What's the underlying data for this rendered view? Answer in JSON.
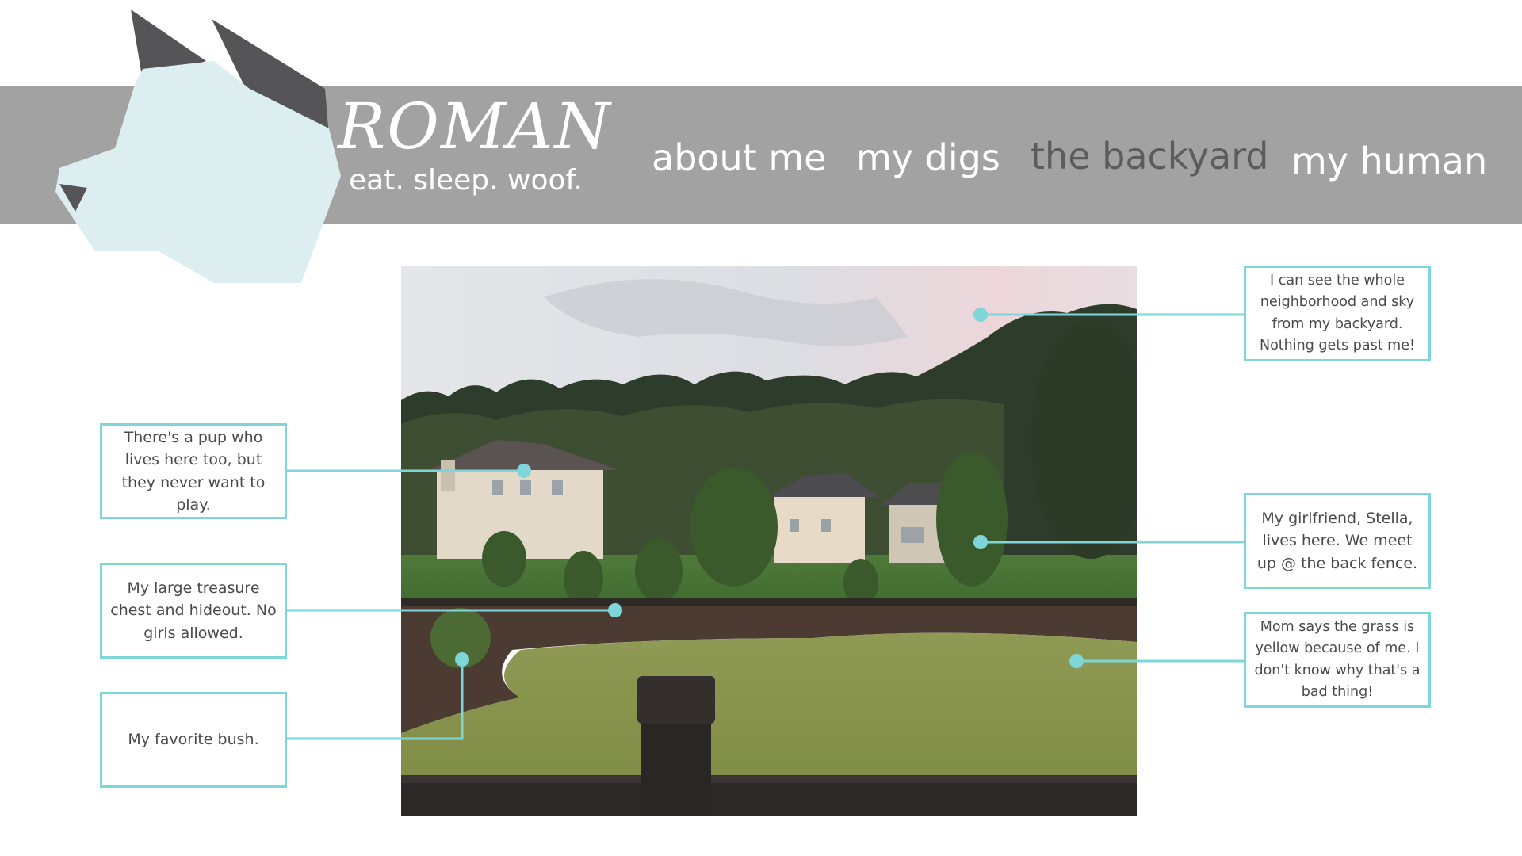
{
  "brand": {
    "title": "ROMAN",
    "tagline": "eat. sleep. woof."
  },
  "nav": {
    "items": [
      {
        "label": "about me",
        "active": false
      },
      {
        "label": "my digs",
        "active": false
      },
      {
        "label": "the backyard",
        "active": true
      },
      {
        "label": "my human",
        "active": false
      }
    ]
  },
  "photo": {
    "subject": "backyard-photo"
  },
  "callouts": {
    "left": [
      "There's a pup who lives here too, but they never want to play.",
      "My large treasure chest and hideout. No girls allowed.",
      "My favorite bush."
    ],
    "right": [
      "I can see the whole neighborhood and sky from my backyard. Nothing gets past me!",
      "My girlfriend, Stella, lives here. We meet up @ the back fence.",
      "Mom says the grass is yellow because of me. I don't know why that's a bad thing!"
    ]
  },
  "colors": {
    "header_bg": "#a2a2a2",
    "accent": "#7fd6d8",
    "dog_face": "#ddeef1",
    "dog_ears": "#555557",
    "text_dark": "#4a4a4a",
    "nav_active": "#5c5c5c"
  }
}
